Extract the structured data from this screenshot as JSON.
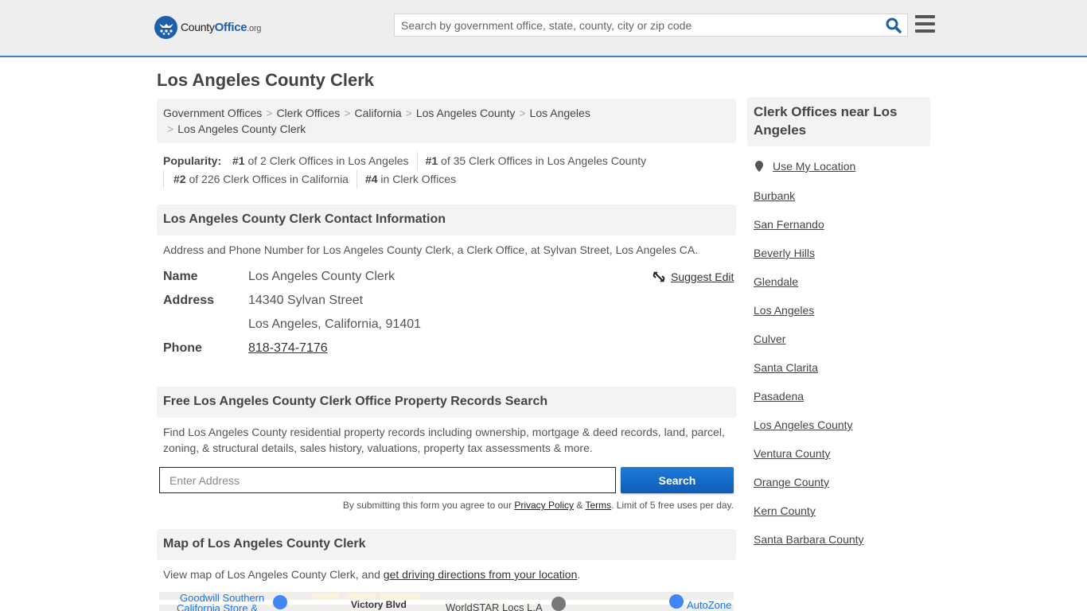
{
  "header": {
    "logo": {
      "brand_plain": "County",
      "brand_bold": "Office",
      "tld": ".org"
    },
    "search": {
      "placeholder": "Search by government office, state, county, city or zip code"
    },
    "icons": {
      "search": "search-icon",
      "menu": "hamburger-menu-icon",
      "logo": "eagle-stars-logo-icon"
    }
  },
  "page": {
    "title": "Los Angeles County Clerk"
  },
  "breadcrumb": [
    "Government Offices",
    "Clerk Offices",
    "California",
    "Los Angeles County",
    "Los Angeles",
    "Los Angeles County Clerk"
  ],
  "popularity": {
    "label": "Popularity:",
    "items": [
      {
        "rank": "#1",
        "text": " of 2 Clerk Offices in Los Angeles"
      },
      {
        "rank": "#1",
        "text": " of 35 Clerk Offices in Los Angeles County"
      },
      {
        "rank": "#2",
        "text": " of 226 Clerk Offices in California"
      },
      {
        "rank": "#4",
        "text": " in Clerk Offices"
      }
    ]
  },
  "contact": {
    "heading": "Los Angeles County Clerk Contact Information",
    "description": "Address and Phone Number for Los Angeles County Clerk, a Clerk Office, at Sylvan Street, Los Angeles CA.",
    "suggest_edit": "Suggest Edit",
    "name_label": "Name",
    "name_value": "Los Angeles County Clerk",
    "address_label": "Address",
    "address_line1": "14340 Sylvan Street",
    "address_line2": "Los Angeles, California, 91401",
    "phone_label": "Phone",
    "phone_value": "818-374-7176"
  },
  "property": {
    "heading": "Free Los Angeles County Clerk Office Property Records Search",
    "description": "Find Los Angeles County residential property records including ownership, mortgage & deed records, land, parcel, zoning, & structural details, sales history, valuations, property tax assessments & more.",
    "input_placeholder": "Enter Address",
    "button_label": "Search",
    "disclaimer_pre": "By submitting this form you agree to our ",
    "privacy_link": "Privacy Policy",
    "amp": " & ",
    "terms_link": "Terms",
    "disclaimer_post": ". Limit of 5 free uses per day."
  },
  "map_section": {
    "heading": "Map of Los Angeles County Clerk",
    "text_pre": "View map of Los Angeles County Clerk, and ",
    "directions_link": "get driving directions from your location",
    "text_post": ".",
    "map_labels": [
      "Goodwill Southern",
      "California Store &",
      "Victory Blvd",
      "WorldSTAR Locs L.A",
      "AutoZone"
    ]
  },
  "sidebar": {
    "heading": "Clerk Offices near Los Angeles",
    "use_location": "Use My Location",
    "links": [
      "Burbank",
      "San Fernando",
      "Beverly Hills",
      "Glendale",
      "Los Angeles",
      "Culver",
      "Santa Clarita",
      "Pasadena",
      "Los Angeles County",
      "Ventura County",
      "Orange County",
      "Kern County",
      "Santa Barbara County"
    ]
  }
}
